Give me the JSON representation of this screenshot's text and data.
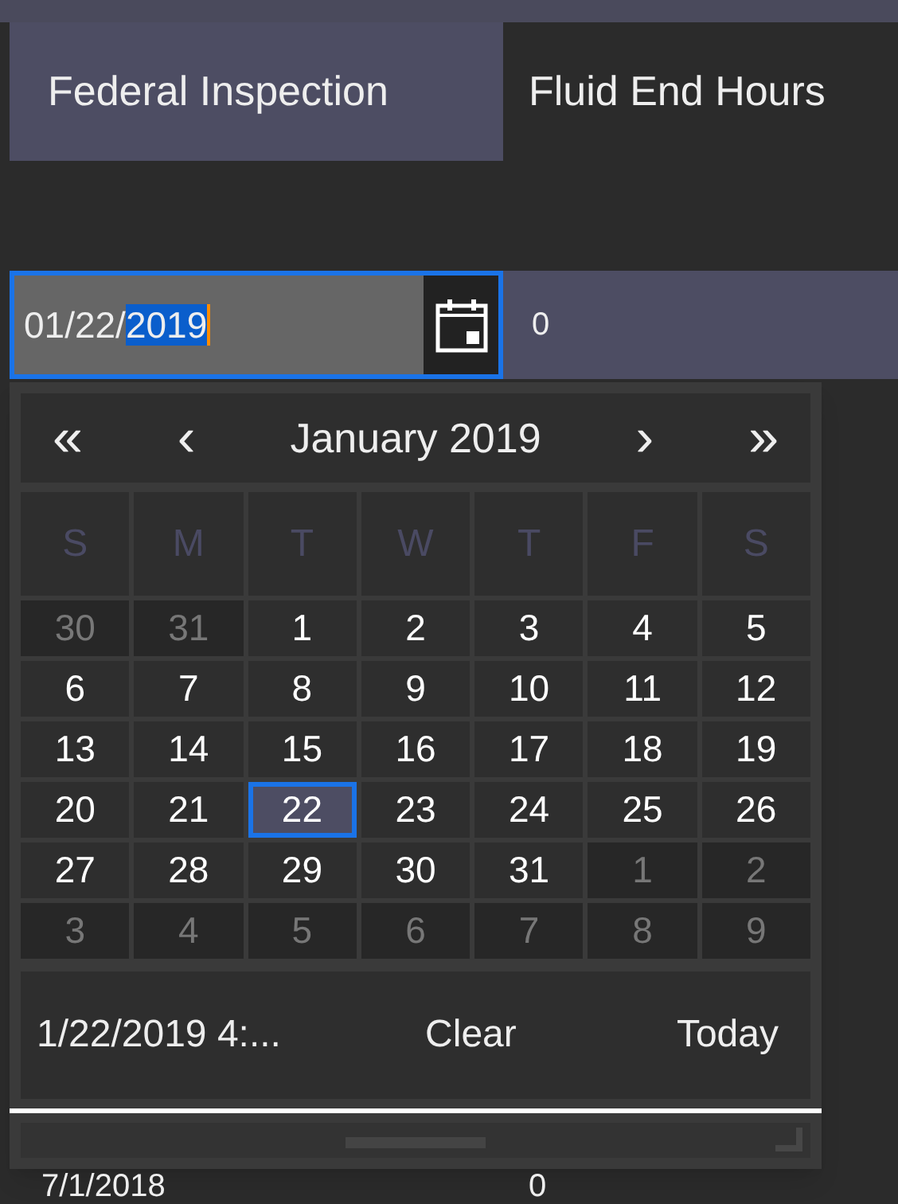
{
  "tabs": [
    {
      "label": "Federal Inspection",
      "selected": true
    },
    {
      "label": "Fluid End Hours",
      "selected": false
    }
  ],
  "date_field": {
    "text": "01/22/",
    "selected_text": "2019",
    "focused": true
  },
  "hours_cell": "0",
  "calendar": {
    "prev_year": "«",
    "prev_month": "‹",
    "title": "January 2019",
    "next_month": "›",
    "next_year": "»",
    "weekdays": [
      "S",
      "M",
      "T",
      "W",
      "T",
      "F",
      "S"
    ],
    "weeks": [
      [
        {
          "day": "30",
          "other_month": true,
          "selected": false
        },
        {
          "day": "31",
          "other_month": true,
          "selected": false
        },
        {
          "day": "1",
          "other_month": false,
          "selected": false
        },
        {
          "day": "2",
          "other_month": false,
          "selected": false
        },
        {
          "day": "3",
          "other_month": false,
          "selected": false
        },
        {
          "day": "4",
          "other_month": false,
          "selected": false
        },
        {
          "day": "5",
          "other_month": false,
          "selected": false
        }
      ],
      [
        {
          "day": "6",
          "other_month": false,
          "selected": false
        },
        {
          "day": "7",
          "other_month": false,
          "selected": false
        },
        {
          "day": "8",
          "other_month": false,
          "selected": false
        },
        {
          "day": "9",
          "other_month": false,
          "selected": false
        },
        {
          "day": "10",
          "other_month": false,
          "selected": false
        },
        {
          "day": "11",
          "other_month": false,
          "selected": false
        },
        {
          "day": "12",
          "other_month": false,
          "selected": false
        }
      ],
      [
        {
          "day": "13",
          "other_month": false,
          "selected": false
        },
        {
          "day": "14",
          "other_month": false,
          "selected": false
        },
        {
          "day": "15",
          "other_month": false,
          "selected": false
        },
        {
          "day": "16",
          "other_month": false,
          "selected": false
        },
        {
          "day": "17",
          "other_month": false,
          "selected": false
        },
        {
          "day": "18",
          "other_month": false,
          "selected": false
        },
        {
          "day": "19",
          "other_month": false,
          "selected": false
        }
      ],
      [
        {
          "day": "20",
          "other_month": false,
          "selected": false
        },
        {
          "day": "21",
          "other_month": false,
          "selected": false
        },
        {
          "day": "22",
          "other_month": false,
          "selected": true
        },
        {
          "day": "23",
          "other_month": false,
          "selected": false
        },
        {
          "day": "24",
          "other_month": false,
          "selected": false
        },
        {
          "day": "25",
          "other_month": false,
          "selected": false
        },
        {
          "day": "26",
          "other_month": false,
          "selected": false
        }
      ],
      [
        {
          "day": "27",
          "other_month": false,
          "selected": false
        },
        {
          "day": "28",
          "other_month": false,
          "selected": false
        },
        {
          "day": "29",
          "other_month": false,
          "selected": false
        },
        {
          "day": "30",
          "other_month": false,
          "selected": false
        },
        {
          "day": "31",
          "other_month": false,
          "selected": false
        },
        {
          "day": "1",
          "other_month": true,
          "selected": false
        },
        {
          "day": "2",
          "other_month": true,
          "selected": false
        }
      ],
      [
        {
          "day": "3",
          "other_month": true,
          "selected": false
        },
        {
          "day": "4",
          "other_month": true,
          "selected": false
        },
        {
          "day": "5",
          "other_month": true,
          "selected": false
        },
        {
          "day": "6",
          "other_month": true,
          "selected": false
        },
        {
          "day": "7",
          "other_month": true,
          "selected": false
        },
        {
          "day": "8",
          "other_month": true,
          "selected": false
        },
        {
          "day": "9",
          "other_month": true,
          "selected": false
        }
      ]
    ],
    "current_value": "1/22/2019 4:...",
    "clear": "Clear",
    "today": "Today"
  },
  "next_row": {
    "date": "7/1/2018",
    "hours": "0"
  }
}
